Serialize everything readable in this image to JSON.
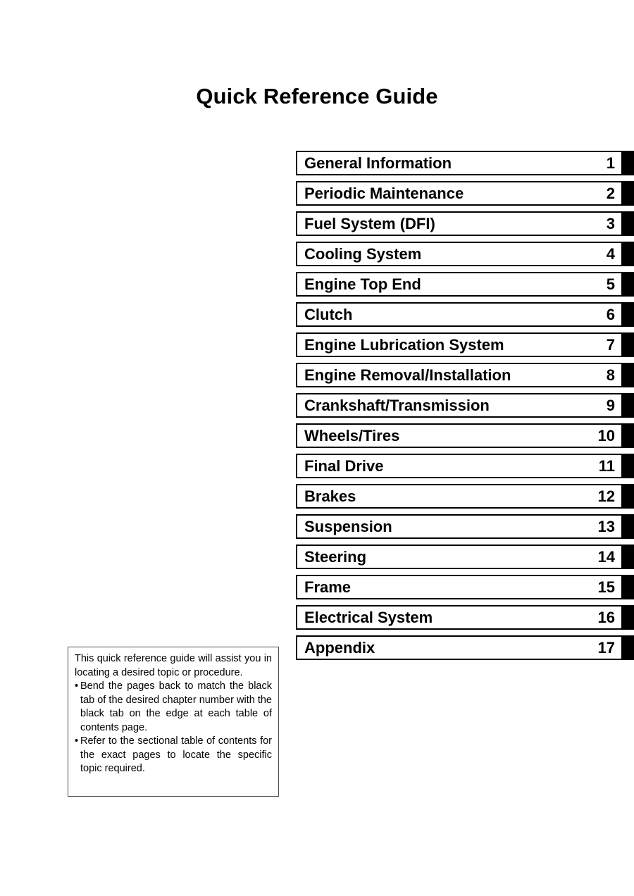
{
  "document": {
    "title": "Quick Reference Guide"
  },
  "chapter_index": [
    {
      "title": "General Information",
      "number": "1"
    },
    {
      "title": "Periodic Maintenance",
      "number": "2"
    },
    {
      "title": "Fuel System (DFI)",
      "number": "3"
    },
    {
      "title": "Cooling System",
      "number": "4"
    },
    {
      "title": "Engine Top End",
      "number": "5"
    },
    {
      "title": "Clutch",
      "number": "6"
    },
    {
      "title": "Engine Lubrication System",
      "number": "7"
    },
    {
      "title": "Engine Removal/Installation",
      "number": "8"
    },
    {
      "title": "Crankshaft/Transmission",
      "number": "9"
    },
    {
      "title": "Wheels/Tires",
      "number": "10"
    },
    {
      "title": "Final Drive",
      "number": "11"
    },
    {
      "title": "Brakes",
      "number": "12"
    },
    {
      "title": "Suspension",
      "number": "13"
    },
    {
      "title": "Steering",
      "number": "14"
    },
    {
      "title": "Frame",
      "number": "15"
    },
    {
      "title": "Electrical System",
      "number": "16"
    },
    {
      "title": "Appendix",
      "number": "17"
    }
  ],
  "note": {
    "intro": "This quick reference guide will assist you in locating a desired topic or procedure.",
    "bullet_glyph": "•",
    "bullets": [
      "Bend the pages back to match the black tab of the desired chapter number with the black tab on the edge at each table of contents page.",
      "Refer to the sectional table of contents for the exact pages to locate the specific topic required."
    ]
  },
  "colors": {
    "text": "#000000",
    "tab_black": "#000000",
    "row_border": "#000000",
    "note_border": "#4a4a4a",
    "page_background": "#ffffff"
  }
}
